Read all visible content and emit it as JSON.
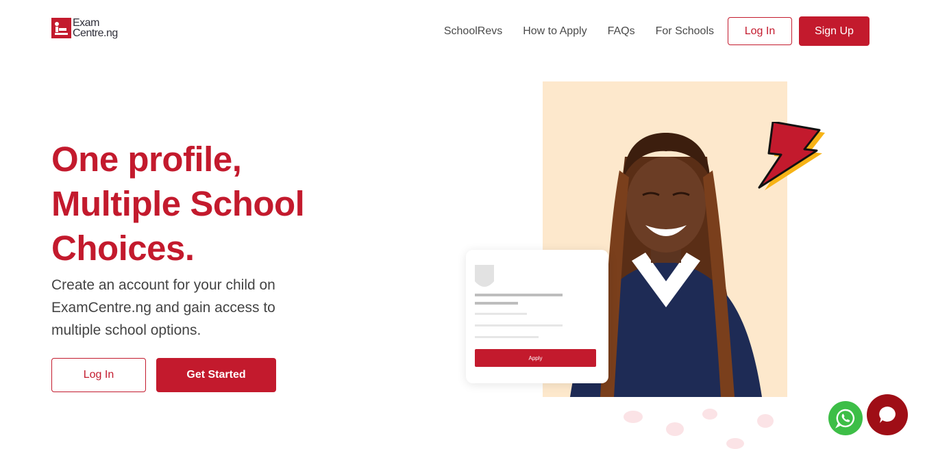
{
  "header": {
    "logo_line1": "Exam",
    "logo_line2": "Centre.ng",
    "nav": [
      "SchoolRevs",
      "How to Apply",
      "FAQs",
      "For Schools"
    ],
    "login_label": "Log In",
    "signup_label": "Sign Up"
  },
  "hero": {
    "title_line1": "One profile,",
    "title_line2": "Multiple School",
    "title_line3": "Choices.",
    "description": "Create an account for your child on ExamCentre.ng and gain access to multiple school options.",
    "login_label": "Log In",
    "cta_label": "Get Started"
  },
  "illustration": {
    "apply_label": "Apply"
  },
  "colors": {
    "brand": "#c31a2d",
    "photo_bg": "#fde8cc",
    "whatsapp": "#3dbe47",
    "chat": "#9f0e16"
  },
  "icons": {
    "logo": "logo-mark-icon",
    "bolt": "lightning-bolt-icon",
    "whatsapp": "whatsapp-icon",
    "chat": "chat-icon"
  }
}
